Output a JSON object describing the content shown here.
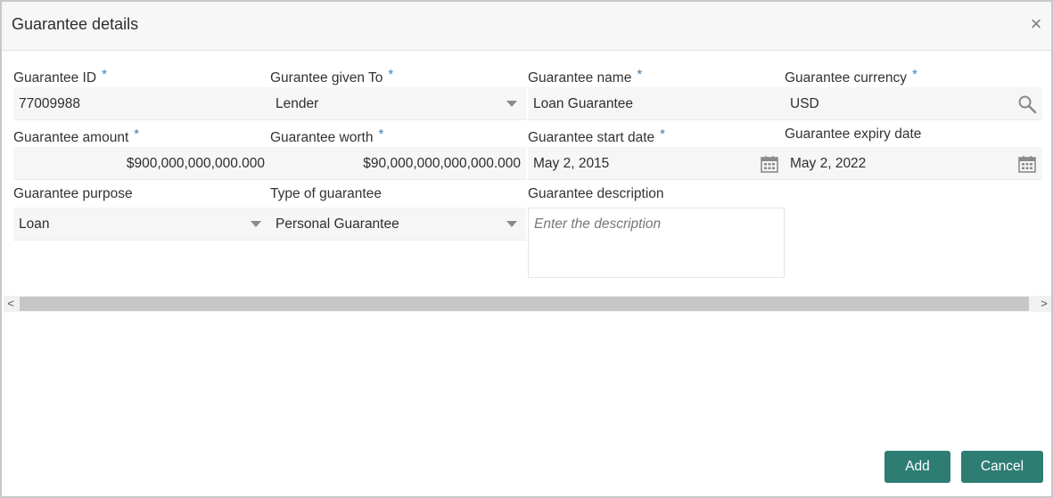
{
  "dialog": {
    "title": "Guarantee details",
    "close_glyph": "×",
    "required_mark": "*"
  },
  "fields": {
    "guarantee_id": {
      "label": "Guarantee ID",
      "value": "77009988"
    },
    "given_to": {
      "label": "Gurantee given To",
      "value": "Lender"
    },
    "name": {
      "label": "Guarantee name",
      "value": "Loan Guarantee"
    },
    "currency": {
      "label": "Guarantee currency",
      "value": "USD"
    },
    "amount": {
      "label": "Guarantee amount",
      "value": "$900,000,000,000.000"
    },
    "worth": {
      "label": "Guarantee worth",
      "value": "$90,000,000,000,000.000"
    },
    "start_date": {
      "label": "Guarantee start date",
      "value": "May 2, 2015"
    },
    "expiry_date": {
      "label": "Guarantee expiry date",
      "value": "May 2, 2022"
    },
    "purpose": {
      "label": "Guarantee purpose",
      "value": "Loan"
    },
    "type": {
      "label": "Type of guarantee",
      "value": "Personal Guarantee"
    },
    "description": {
      "label": "Guarantee description",
      "placeholder": "Enter the description",
      "value": ""
    }
  },
  "scrollbar": {
    "left_arrow": "<",
    "right_arrow": ">"
  },
  "actions": {
    "add_label": "Add",
    "cancel_label": "Cancel"
  },
  "colors": {
    "primary_button": "#2d7d73",
    "required": "#3a7fb5",
    "field_bg": "#f7f6f6"
  },
  "icons": [
    "close-icon",
    "search-icon",
    "calendar-icon",
    "dropdown-caret-icon",
    "scroll-left-icon",
    "scroll-right-icon"
  ]
}
